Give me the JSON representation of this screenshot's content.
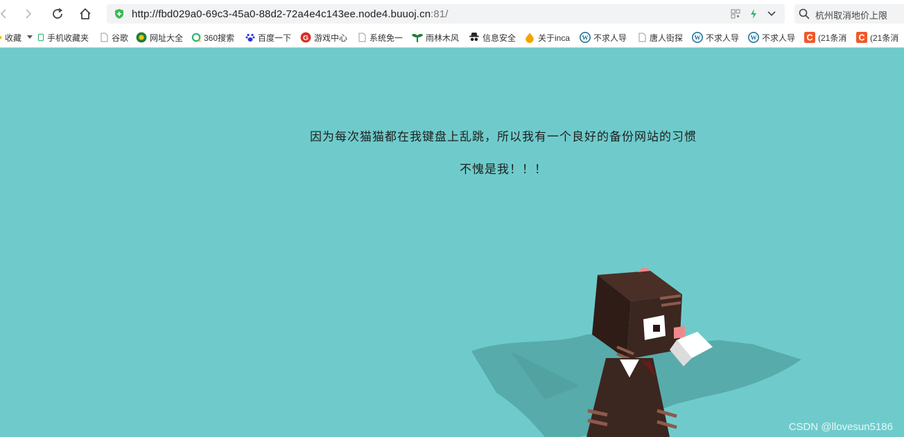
{
  "browser": {
    "url_host": "http://fbd029a0-69c3-45a0-88d2-72a4e4c143ee.node4.buuoj.cn",
    "url_port_path": ":81/",
    "search_text": "杭州取消地价上限"
  },
  "bookmarks": [
    {
      "label": "收藏",
      "icon": "star-icon"
    },
    {
      "label": "手机收藏夹",
      "icon": "phone-icon"
    },
    {
      "label": "谷歌",
      "icon": "page-icon"
    },
    {
      "label": "网址大全",
      "icon": "globe-icon"
    },
    {
      "label": "360搜索",
      "icon": "search360-icon"
    },
    {
      "label": "百度一下",
      "icon": "baidu-paw-icon"
    },
    {
      "label": "游戏中心",
      "icon": "game-icon"
    },
    {
      "label": "系统免一",
      "icon": "page-icon"
    },
    {
      "label": "雨林木风",
      "icon": "tree-icon"
    },
    {
      "label": "信息安全",
      "icon": "spy-icon"
    },
    {
      "label": "关于inca",
      "icon": "flame-icon"
    },
    {
      "label": "不求人导",
      "icon": "wordpress-icon"
    },
    {
      "label": "唐人街探",
      "icon": "page-icon"
    },
    {
      "label": "不求人导",
      "icon": "wordpress-icon"
    },
    {
      "label": "不求人导",
      "icon": "wordpress-icon"
    },
    {
      "label": "(21条消",
      "icon": "csdn-icon"
    },
    {
      "label": "(21条消",
      "icon": "csdn-icon"
    }
  ],
  "page": {
    "line1": "因为每次猫猫都在我键盘上乱跳，所以我有一个良好的备份网站的习惯",
    "line2": "不愧是我！！！",
    "watermark": "CSDN @llovesun5186",
    "bg_color": "#6fcbcb"
  }
}
